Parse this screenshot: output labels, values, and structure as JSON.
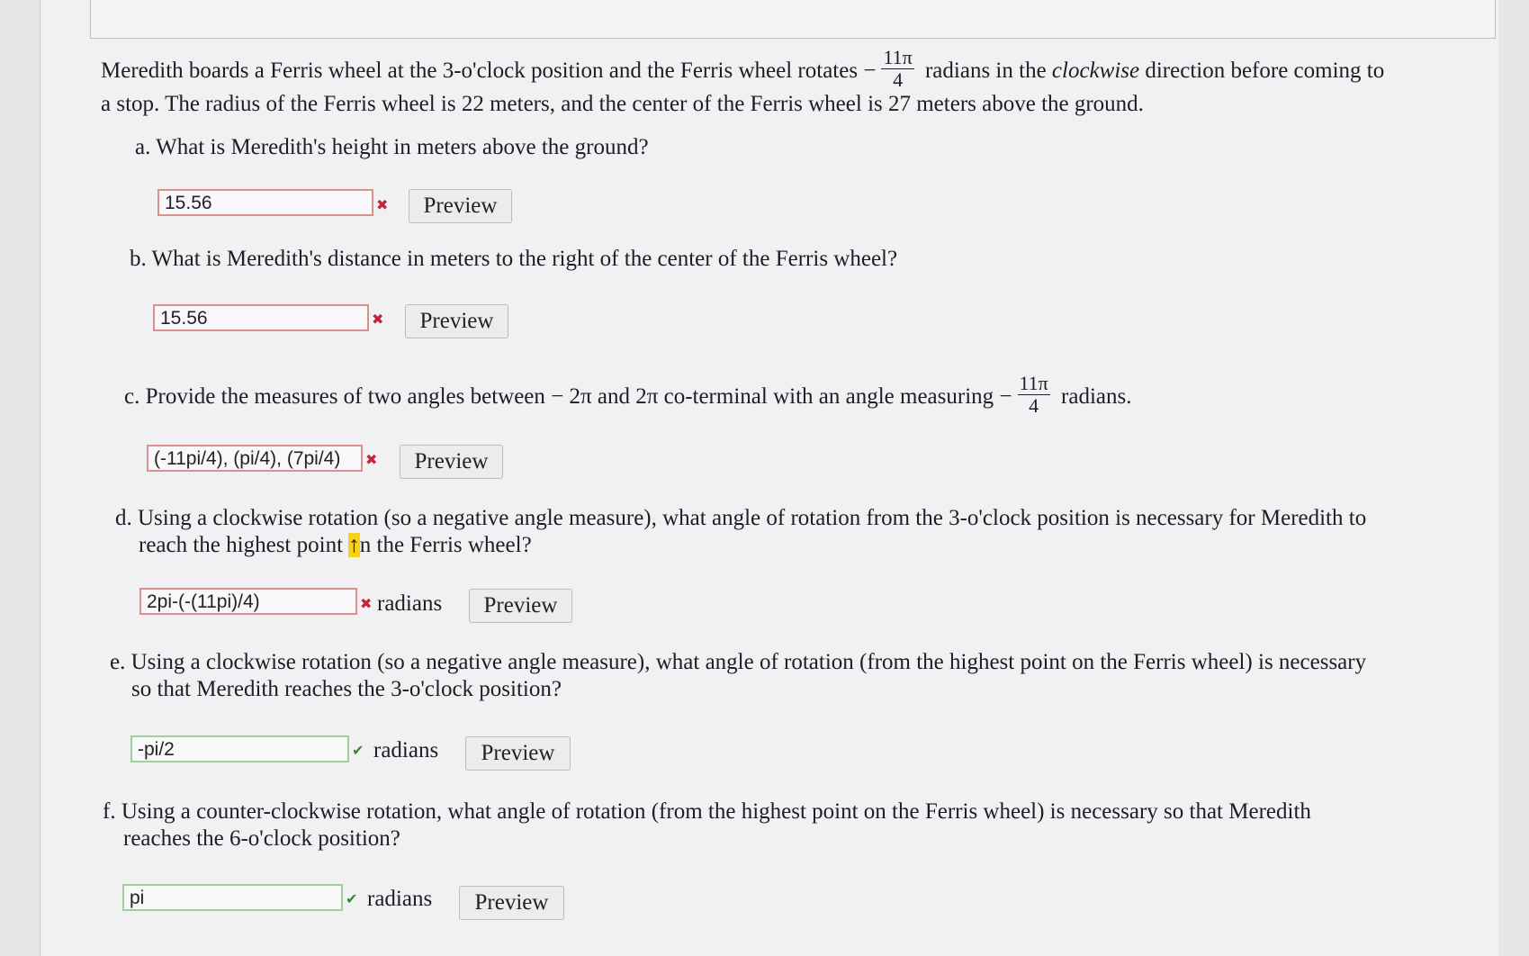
{
  "problem": {
    "intro_1": "Meredith boards a Ferris wheel at the 3-o'clock position and the Ferris wheel rotates",
    "minus": "−",
    "frac_num": "11π",
    "frac_den": "4",
    "intro_2": "radians in the",
    "intro_em": "clockwise",
    "intro_3": "direction before coming to",
    "intro_line2": "a stop. The radius of the Ferris wheel is 22 meters, and the center of the Ferris wheel is 27 meters above the ground."
  },
  "questions": {
    "a": {
      "text": "a. What is Meredith's height in meters above the ground?",
      "answer": "15.56",
      "status": "incorrect"
    },
    "b": {
      "text": "b. What is Meredith's distance in meters to the right of the center of the Ferris wheel?",
      "answer": "15.56",
      "status": "incorrect"
    },
    "c": {
      "text_1": "c. Provide the measures of two angles between − 2π and 2π co-terminal with an angle measuring",
      "minus": "−",
      "frac_num": "11π",
      "frac_den": "4",
      "text_2": "radians.",
      "answer": "(-11pi/4), (pi/4), (7pi/4)",
      "status": "incorrect"
    },
    "d": {
      "line1": "d. Using a clockwise rotation (so a negative angle measure), what angle of rotation from the 3-o'clock position is necessary for Meredith to",
      "line2_a": "reach the highest point ",
      "cursor": "↑",
      "line2_b": "n the Ferris wheel?",
      "answer": "2pi-(-(11pi)/4)",
      "unit": "radians",
      "status": "incorrect"
    },
    "e": {
      "line1": "e. Using a clockwise rotation (so a negative angle measure), what angle of rotation (from the highest point on the Ferris wheel) is necessary",
      "line2": "so that Meredith reaches the 3-o'clock position?",
      "answer": "-pi/2",
      "unit": "radians",
      "status": "correct"
    },
    "f": {
      "line1": "f. Using a counter-clockwise rotation, what angle of rotation (from the highest point on the Ferris wheel) is necessary so that Meredith",
      "line2": "reaches the 6-o'clock position?",
      "answer": "pi",
      "unit": "radians",
      "status": "correct"
    }
  },
  "buttons": {
    "preview": "Preview"
  },
  "marks": {
    "incorrect": "✖",
    "correct": "✔"
  },
  "colors": {
    "incorrect_border": "#d9908f",
    "correct_border": "#9dd19a",
    "incorrect_icon": "#c4243a",
    "correct_icon": "#2f8a3a",
    "cursor_highlight": "#f4d21a"
  }
}
